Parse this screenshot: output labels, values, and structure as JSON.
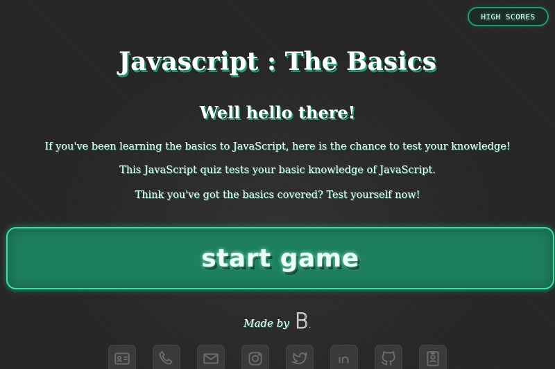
{
  "header": {
    "high_scores_label": "HIGH SCORES"
  },
  "main": {
    "title": "Javascript : The Basics",
    "greeting": "Well hello there!",
    "paragraphs": [
      "If you've been learning the basics to JavaScript, here is the chance to test your knowledge!",
      "This JavaScript quiz tests your basic knowledge of JavaScript.",
      "Think you've got the basics covered? Test yourself now!"
    ],
    "start_label": "start game"
  },
  "footer": {
    "made_by": "Made by",
    "logo": "B",
    "social_icons": [
      "contact-card-icon",
      "phone-icon",
      "mail-icon",
      "instagram-icon",
      "twitter-icon",
      "linkedin-icon",
      "github-icon",
      "portfolio-icon"
    ]
  },
  "colors": {
    "background": "#262626",
    "accent": "#1f9b72",
    "accent_glow": "#3fe0a6",
    "button_fill": "#1e7f5f"
  }
}
